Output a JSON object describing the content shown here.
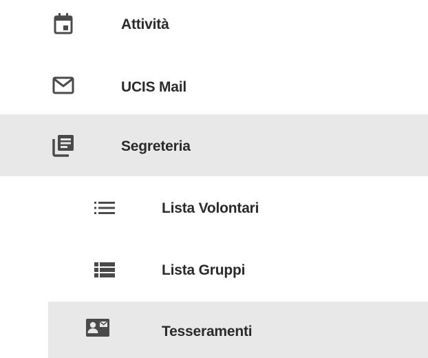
{
  "nav": {
    "items": [
      {
        "label": "Attività",
        "icon": "calendar-icon"
      },
      {
        "label": "UCIS Mail",
        "icon": "mail-icon"
      },
      {
        "label": "Segreteria",
        "icon": "library-books-icon",
        "state": "expanded-highlighted"
      },
      {
        "label": "Lista Volontari",
        "icon": "list-icon",
        "level": 2
      },
      {
        "label": "Lista Gruppi",
        "icon": "view-list-icon",
        "level": 2
      },
      {
        "label": "Tesseramenti",
        "icon": "contact-mail-icon",
        "level": 2,
        "state": "selected"
      }
    ]
  },
  "colors": {
    "highlight_bg": "#e8e8e8",
    "text": "#2a2a2a",
    "icon": "#4a4a4a"
  }
}
